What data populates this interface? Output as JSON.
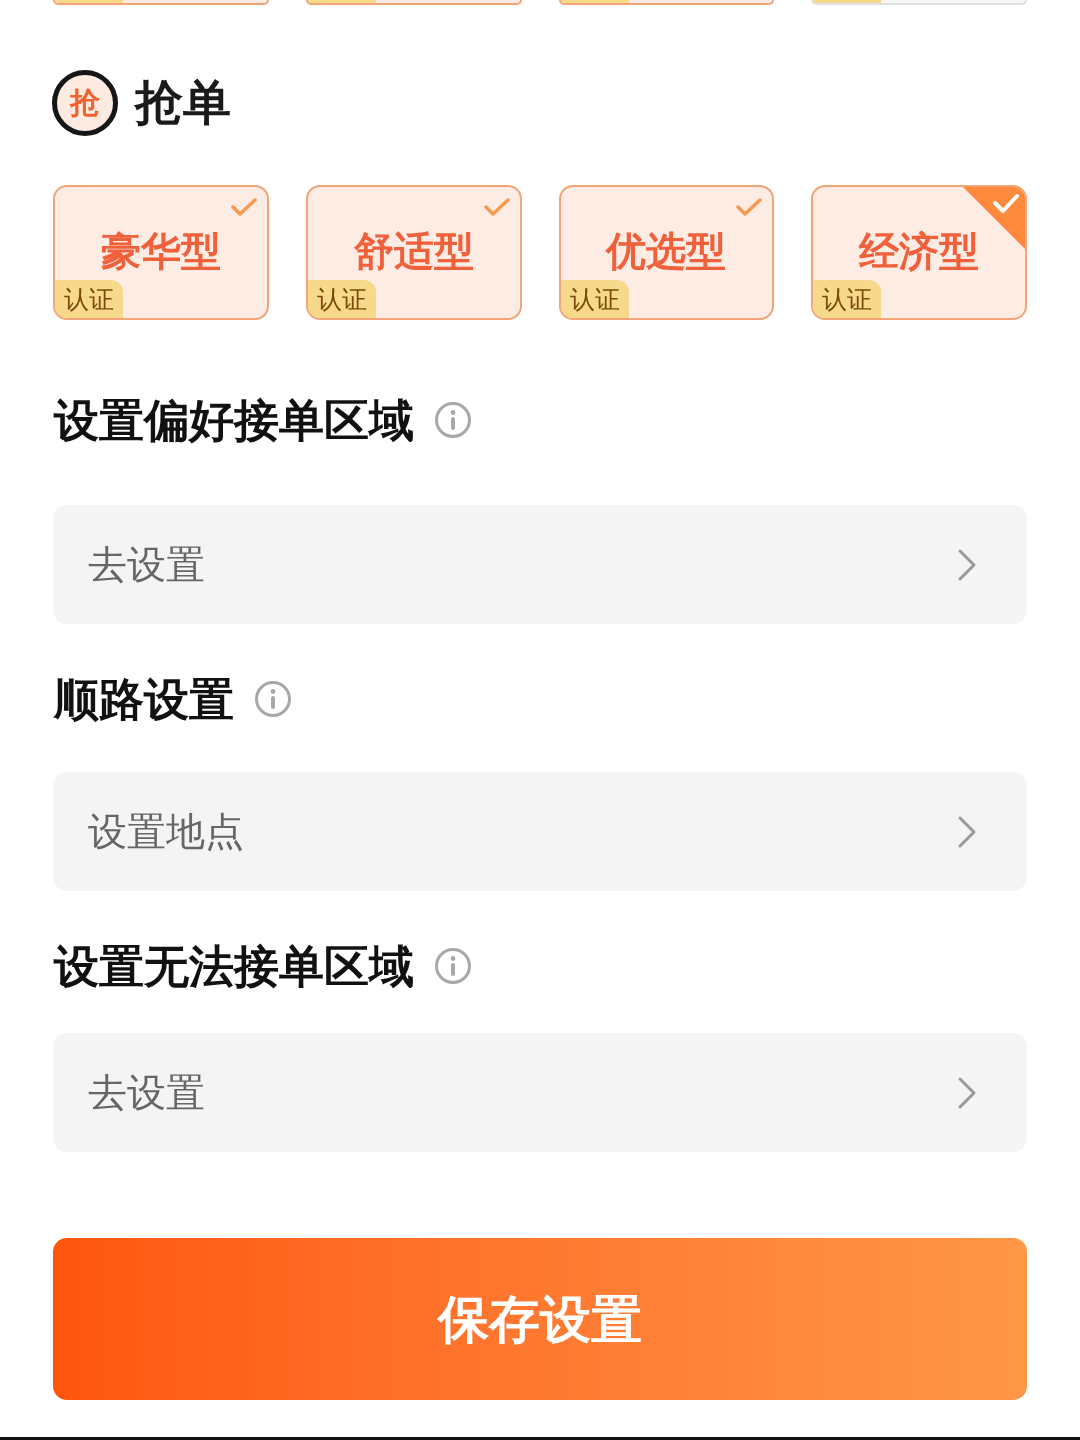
{
  "top_cards": [
    {
      "selected": true
    },
    {
      "selected": true
    },
    {
      "selected": true
    },
    {
      "selected": false
    }
  ],
  "section": {
    "badge_char": "抢",
    "title": "抢单"
  },
  "car_types": [
    {
      "label": "豪华型",
      "badge": "认证",
      "selected": false
    },
    {
      "label": "舒适型",
      "badge": "认证",
      "selected": false
    },
    {
      "label": "优选型",
      "badge": "认证",
      "selected": false
    },
    {
      "label": "经济型",
      "badge": "认证",
      "selected": true
    }
  ],
  "settings": [
    {
      "title": "设置偏好接单区域",
      "action": "去设置"
    },
    {
      "title": "顺路设置",
      "action": "设置地点"
    },
    {
      "title": "设置无法接单区域",
      "action": "去设置"
    }
  ],
  "save_button": "保存设置"
}
